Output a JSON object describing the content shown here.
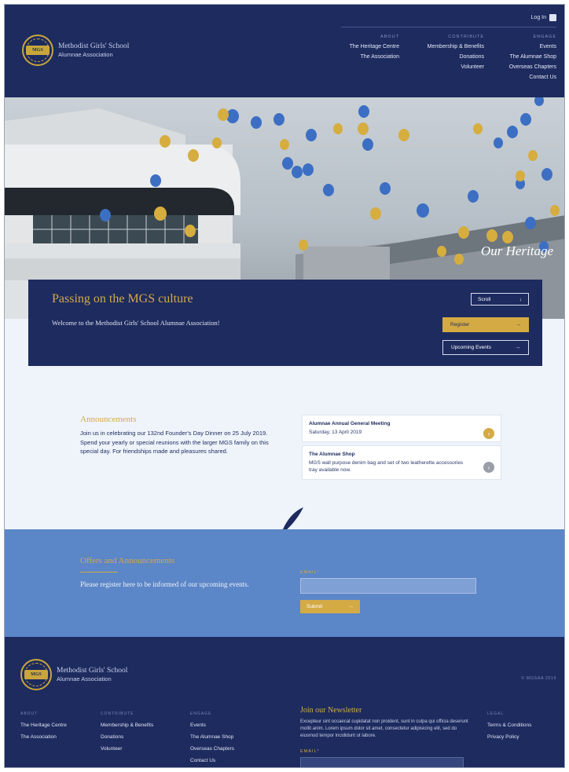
{
  "header": {
    "logo_line1": "Methodist Girls' School",
    "logo_line2": "Alumnae Association",
    "seal_text": "MGS",
    "login_label": "Log In",
    "nav": [
      {
        "heading": "ABOUT",
        "items": [
          "The Heritage Centre",
          "The Association"
        ]
      },
      {
        "heading": "CONTRIBUTE",
        "items": [
          "Membership & Benefits",
          "Donations",
          "Volunteer"
        ]
      },
      {
        "heading": "ENGAGE",
        "items": [
          "Events",
          "The Alumnae Shop",
          "Overseas Chapters",
          "Contact Us"
        ]
      }
    ]
  },
  "hero": {
    "caption": "Our Heritage"
  },
  "banner": {
    "title": "Passing on the MGS culture",
    "welcome": "Welcome to the Methodist Girls' School Alumnae Association!",
    "scroll_label": "Scroll",
    "register_label": "Register",
    "events_label": "Upcoming Events"
  },
  "announcements": {
    "title": "Announcements",
    "body": "Join us in celebrating our 132nd Founder's Day Dinner on 25 July 2019. Spend your yearly or special reunions with the larger MGS family on this special day. For friendships made and pleasures shared.",
    "cards": [
      {
        "title": "Alumnae Annual General Meeting",
        "sub": "Saturday, 13 April 2019"
      },
      {
        "title": "The Alumnae Shop",
        "sub": "MGS wall purpose denim bag and set of two leatherette accessories tray available now."
      }
    ]
  },
  "offers": {
    "title": "Offers and Announcements",
    "text": "Please register here to be informed of our upcoming events.",
    "email_label": "EMAIL*",
    "submit_label": "Submit"
  },
  "footer": {
    "copyright": "© MGSAA 2019",
    "columns": [
      {
        "heading": "ABOUT",
        "items": [
          "The Heritage Centre",
          "The Association"
        ]
      },
      {
        "heading": "CONTRIBUTE",
        "items": [
          "Membership & Benefits",
          "Donations",
          "Volunteer"
        ]
      },
      {
        "heading": "ENGAGE",
        "items": [
          "Events",
          "The Alumnae Shop",
          "Overseas Chapters",
          "Contact Us"
        ]
      },
      {
        "heading": "LEGAL",
        "items": [
          "Terms & Conditions",
          "Privacy Policy"
        ]
      }
    ],
    "newsletter_title": "Join our Newsletter",
    "newsletter_text": "Excepteur sint occaecat cupidatat non proident, sunt in culpa qui officia deserunt mollit anim. Lorem ipsum dolor sit amet, consectetur adipisicing elit, sed do eiusmod tempor incididunt ut labore.",
    "newsletter_label": "EMAIL*"
  },
  "colors": {
    "navy": "#1d2b5f",
    "gold": "#d4aa45",
    "band_blue": "#5b86c7",
    "page_bg": "#eef4fa"
  }
}
